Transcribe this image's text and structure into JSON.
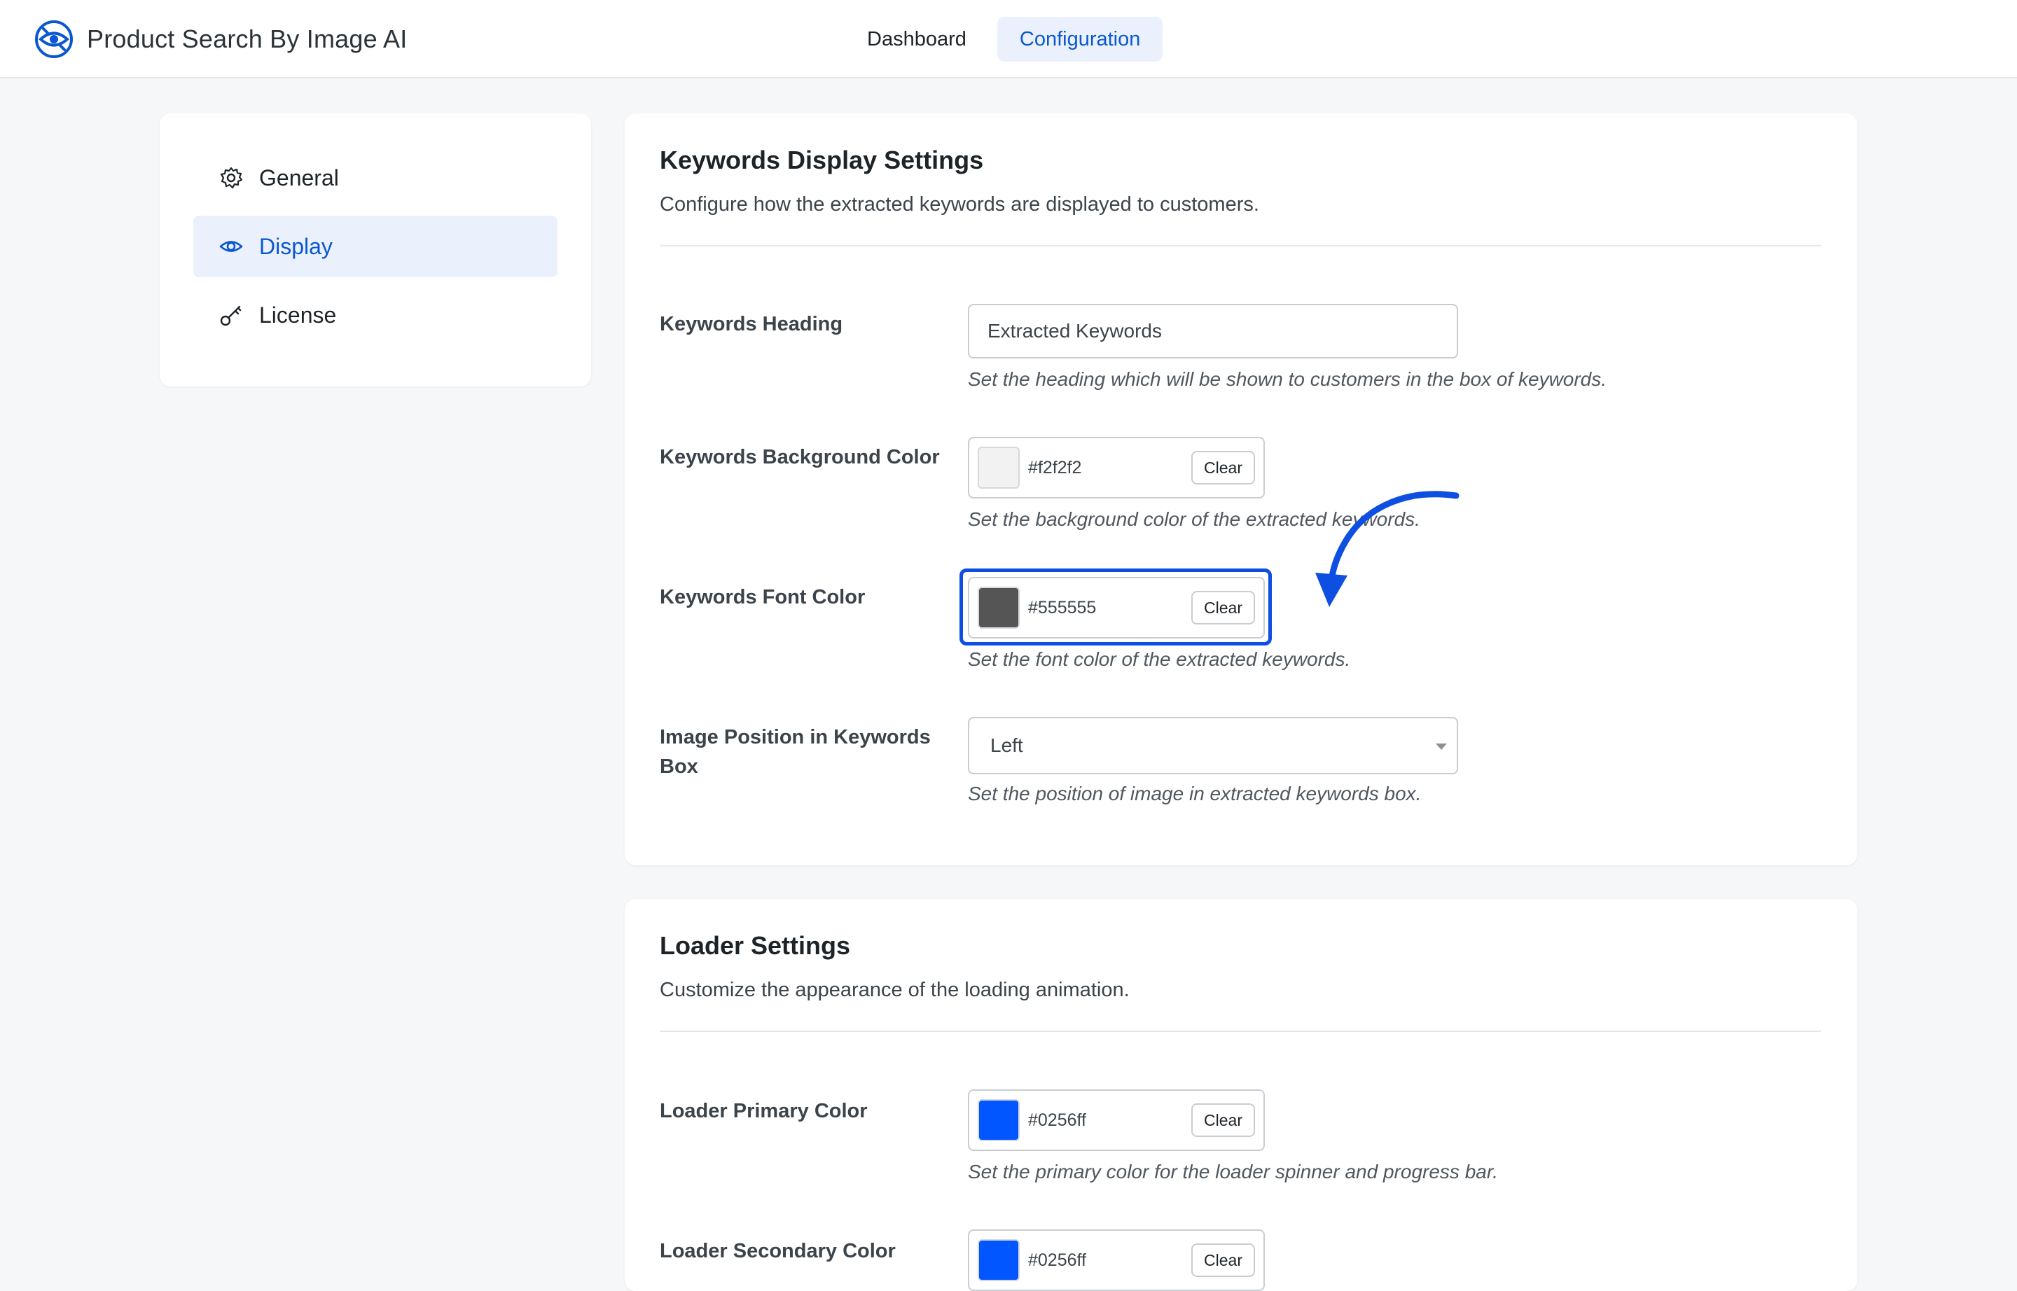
{
  "app": {
    "title": "Product Search By Image AI",
    "logo_icon": "camera-eye-logo-icon",
    "accent_color": "#0b57d0"
  },
  "top_nav": {
    "tabs": [
      {
        "label": "Dashboard",
        "active": false
      },
      {
        "label": "Configuration",
        "active": true
      }
    ]
  },
  "sidebar": {
    "items": [
      {
        "label": "General",
        "icon": "gear-icon",
        "active": false
      },
      {
        "label": "Display",
        "icon": "eye-icon",
        "active": true
      },
      {
        "label": "License",
        "icon": "key-icon",
        "active": false
      }
    ]
  },
  "keywords_section": {
    "title": "Keywords Display Settings",
    "description": "Configure how the extracted keywords are displayed to customers.",
    "heading_field": {
      "label": "Keywords Heading",
      "value": "Extracted Keywords",
      "help": "Set the heading which will be shown to customers in the box of keywords."
    },
    "bg_color_field": {
      "label": "Keywords Background Color",
      "value": "#f2f2f2",
      "swatch": "#f2f2f2",
      "clear_label": "Clear",
      "help": "Set the background color of the extracted keywords."
    },
    "font_color_field": {
      "label": "Keywords Font Color",
      "value": "#555555",
      "swatch": "#555555",
      "clear_label": "Clear",
      "help": "Set the font color of the extracted keywords."
    },
    "image_position_field": {
      "label": "Image Position in Keywords Box",
      "value": "Left",
      "help": "Set the position of image in extracted keywords box."
    }
  },
  "loader_section": {
    "title": "Loader Settings",
    "description": "Customize the appearance of the loading animation.",
    "primary_color_field": {
      "label": "Loader Primary Color",
      "value": "#0256ff",
      "swatch": "#0256ff",
      "clear_label": "Clear",
      "help": "Set the primary color for the loader spinner and progress bar."
    },
    "secondary_color_field": {
      "label": "Loader Secondary Color",
      "value": "#0256ff",
      "swatch": "#0256ff",
      "clear_label": "Clear"
    }
  },
  "annotation": {
    "highlight_color": "#0d4fe0",
    "arrow_color": "#0d4fe0"
  }
}
